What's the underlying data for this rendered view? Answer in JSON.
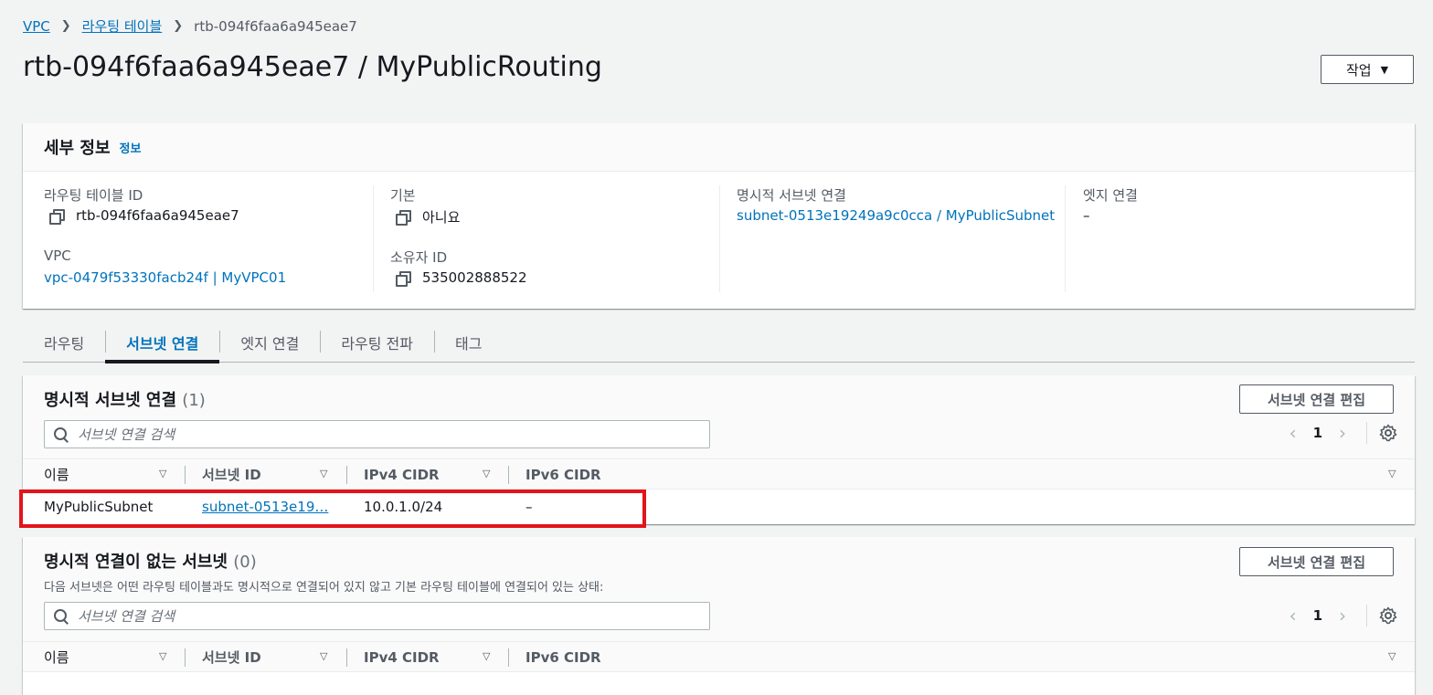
{
  "breadcrumb": {
    "items": [
      "VPC",
      "라우팅 테이블"
    ],
    "current": "rtb-094f6faa6a945eae7"
  },
  "page": {
    "title": "rtb-094f6faa6a945eae7 / MyPublicRouting",
    "actions_label": "작업"
  },
  "details": {
    "title": "세부 정보",
    "info_link": "정보",
    "route_table_id_label": "라우팅 테이블 ID",
    "route_table_id_value": "rtb-094f6faa6a945eae7",
    "vpc_label": "VPC",
    "vpc_value": "vpc-0479f53330facb24f | MyVPC01",
    "main_label": "기본",
    "main_value": "아니요",
    "owner_label": "소유자 ID",
    "owner_value": "535002888522",
    "explicit_assoc_label": "명시적 서브넷 연결",
    "explicit_assoc_value": "subnet-0513e19249a9c0cca / MyPublicSubnet",
    "edge_assoc_label": "엣지 연결",
    "edge_assoc_value": "–"
  },
  "tabs": [
    "라우팅",
    "서브넷 연결",
    "엣지 연결",
    "라우팅 전파",
    "태그"
  ],
  "active_tab": "서브넷 연결",
  "explicit_panel": {
    "title": "명시적 서브넷 연결",
    "count": "(1)",
    "edit_label": "서브넷 연결 편집",
    "search_placeholder": "서브넷 연결 검색",
    "page": "1",
    "columns": [
      "이름",
      "서브넷 ID",
      "IPv4 CIDR",
      "IPv6 CIDR"
    ],
    "rows": [
      {
        "name": "MyPublicSubnet",
        "subnet_id": "subnet-0513e19…",
        "ipv4": "10.0.1.0/24",
        "ipv6": "–"
      }
    ]
  },
  "unassoc_panel": {
    "title": "명시적 연결이 없는 서브넷",
    "count": "(0)",
    "description": "다음 서브넷은 어떤 라우팅 테이블과도 명시적으로 연결되어 있지 않고 기본 라우팅 테이블에 연결되어 있는 상태:",
    "edit_label": "서브넷 연결 편집",
    "search_placeholder": "서브넷 연결 검색",
    "page": "1",
    "columns": [
      "이름",
      "서브넷 ID",
      "IPv4 CIDR",
      "IPv6 CIDR"
    ]
  },
  "colors": {
    "link": "#0073bb",
    "highlight": "#e3141b"
  }
}
